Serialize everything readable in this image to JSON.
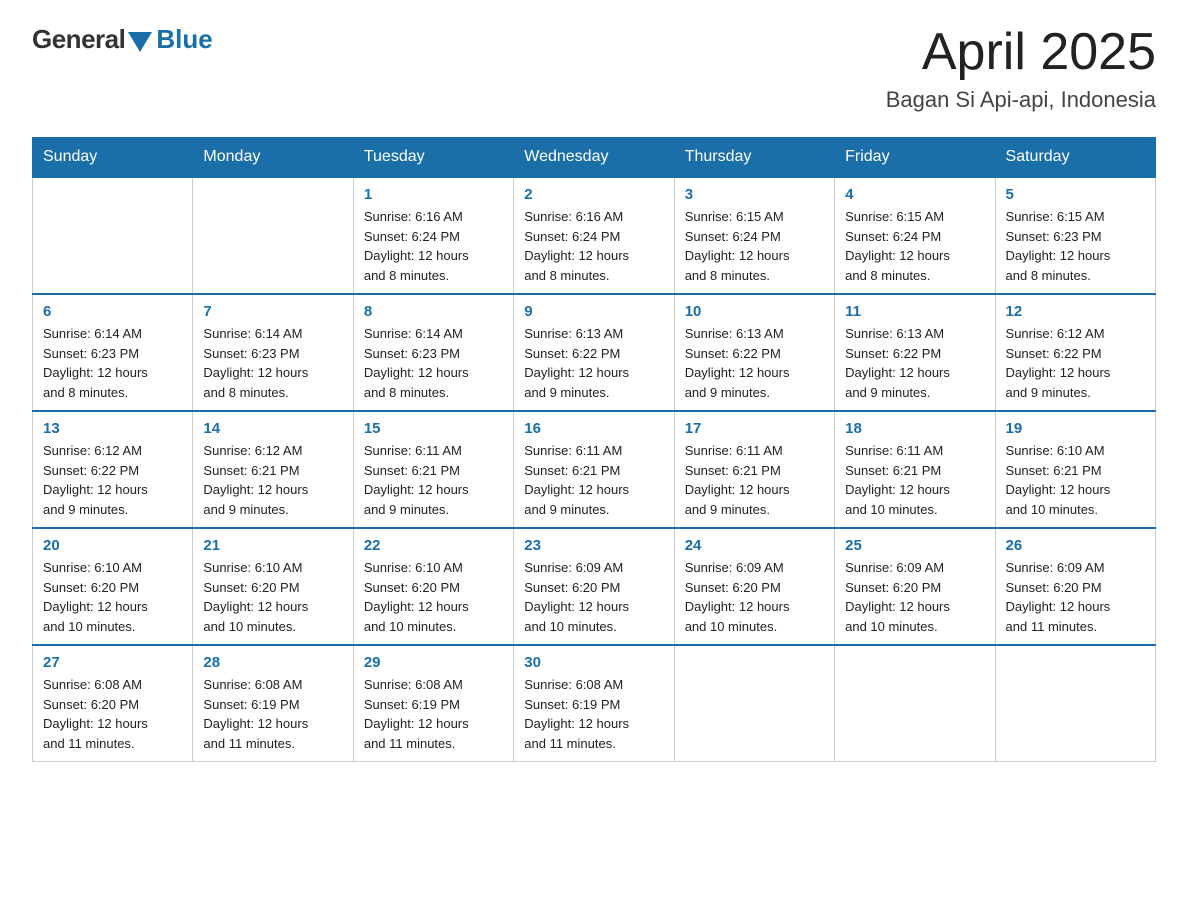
{
  "header": {
    "logo_general": "General",
    "logo_blue": "Blue",
    "title": "April 2025",
    "subtitle": "Bagan Si Api-api, Indonesia"
  },
  "days_of_week": [
    "Sunday",
    "Monday",
    "Tuesday",
    "Wednesday",
    "Thursday",
    "Friday",
    "Saturday"
  ],
  "weeks": [
    [
      {
        "day": "",
        "info": ""
      },
      {
        "day": "",
        "info": ""
      },
      {
        "day": "1",
        "info": "Sunrise: 6:16 AM\nSunset: 6:24 PM\nDaylight: 12 hours\nand 8 minutes."
      },
      {
        "day": "2",
        "info": "Sunrise: 6:16 AM\nSunset: 6:24 PM\nDaylight: 12 hours\nand 8 minutes."
      },
      {
        "day": "3",
        "info": "Sunrise: 6:15 AM\nSunset: 6:24 PM\nDaylight: 12 hours\nand 8 minutes."
      },
      {
        "day": "4",
        "info": "Sunrise: 6:15 AM\nSunset: 6:24 PM\nDaylight: 12 hours\nand 8 minutes."
      },
      {
        "day": "5",
        "info": "Sunrise: 6:15 AM\nSunset: 6:23 PM\nDaylight: 12 hours\nand 8 minutes."
      }
    ],
    [
      {
        "day": "6",
        "info": "Sunrise: 6:14 AM\nSunset: 6:23 PM\nDaylight: 12 hours\nand 8 minutes."
      },
      {
        "day": "7",
        "info": "Sunrise: 6:14 AM\nSunset: 6:23 PM\nDaylight: 12 hours\nand 8 minutes."
      },
      {
        "day": "8",
        "info": "Sunrise: 6:14 AM\nSunset: 6:23 PM\nDaylight: 12 hours\nand 8 minutes."
      },
      {
        "day": "9",
        "info": "Sunrise: 6:13 AM\nSunset: 6:22 PM\nDaylight: 12 hours\nand 9 minutes."
      },
      {
        "day": "10",
        "info": "Sunrise: 6:13 AM\nSunset: 6:22 PM\nDaylight: 12 hours\nand 9 minutes."
      },
      {
        "day": "11",
        "info": "Sunrise: 6:13 AM\nSunset: 6:22 PM\nDaylight: 12 hours\nand 9 minutes."
      },
      {
        "day": "12",
        "info": "Sunrise: 6:12 AM\nSunset: 6:22 PM\nDaylight: 12 hours\nand 9 minutes."
      }
    ],
    [
      {
        "day": "13",
        "info": "Sunrise: 6:12 AM\nSunset: 6:22 PM\nDaylight: 12 hours\nand 9 minutes."
      },
      {
        "day": "14",
        "info": "Sunrise: 6:12 AM\nSunset: 6:21 PM\nDaylight: 12 hours\nand 9 minutes."
      },
      {
        "day": "15",
        "info": "Sunrise: 6:11 AM\nSunset: 6:21 PM\nDaylight: 12 hours\nand 9 minutes."
      },
      {
        "day": "16",
        "info": "Sunrise: 6:11 AM\nSunset: 6:21 PM\nDaylight: 12 hours\nand 9 minutes."
      },
      {
        "day": "17",
        "info": "Sunrise: 6:11 AM\nSunset: 6:21 PM\nDaylight: 12 hours\nand 9 minutes."
      },
      {
        "day": "18",
        "info": "Sunrise: 6:11 AM\nSunset: 6:21 PM\nDaylight: 12 hours\nand 10 minutes."
      },
      {
        "day": "19",
        "info": "Sunrise: 6:10 AM\nSunset: 6:21 PM\nDaylight: 12 hours\nand 10 minutes."
      }
    ],
    [
      {
        "day": "20",
        "info": "Sunrise: 6:10 AM\nSunset: 6:20 PM\nDaylight: 12 hours\nand 10 minutes."
      },
      {
        "day": "21",
        "info": "Sunrise: 6:10 AM\nSunset: 6:20 PM\nDaylight: 12 hours\nand 10 minutes."
      },
      {
        "day": "22",
        "info": "Sunrise: 6:10 AM\nSunset: 6:20 PM\nDaylight: 12 hours\nand 10 minutes."
      },
      {
        "day": "23",
        "info": "Sunrise: 6:09 AM\nSunset: 6:20 PM\nDaylight: 12 hours\nand 10 minutes."
      },
      {
        "day": "24",
        "info": "Sunrise: 6:09 AM\nSunset: 6:20 PM\nDaylight: 12 hours\nand 10 minutes."
      },
      {
        "day": "25",
        "info": "Sunrise: 6:09 AM\nSunset: 6:20 PM\nDaylight: 12 hours\nand 10 minutes."
      },
      {
        "day": "26",
        "info": "Sunrise: 6:09 AM\nSunset: 6:20 PM\nDaylight: 12 hours\nand 11 minutes."
      }
    ],
    [
      {
        "day": "27",
        "info": "Sunrise: 6:08 AM\nSunset: 6:20 PM\nDaylight: 12 hours\nand 11 minutes."
      },
      {
        "day": "28",
        "info": "Sunrise: 6:08 AM\nSunset: 6:19 PM\nDaylight: 12 hours\nand 11 minutes."
      },
      {
        "day": "29",
        "info": "Sunrise: 6:08 AM\nSunset: 6:19 PM\nDaylight: 12 hours\nand 11 minutes."
      },
      {
        "day": "30",
        "info": "Sunrise: 6:08 AM\nSunset: 6:19 PM\nDaylight: 12 hours\nand 11 minutes."
      },
      {
        "day": "",
        "info": ""
      },
      {
        "day": "",
        "info": ""
      },
      {
        "day": "",
        "info": ""
      }
    ]
  ]
}
